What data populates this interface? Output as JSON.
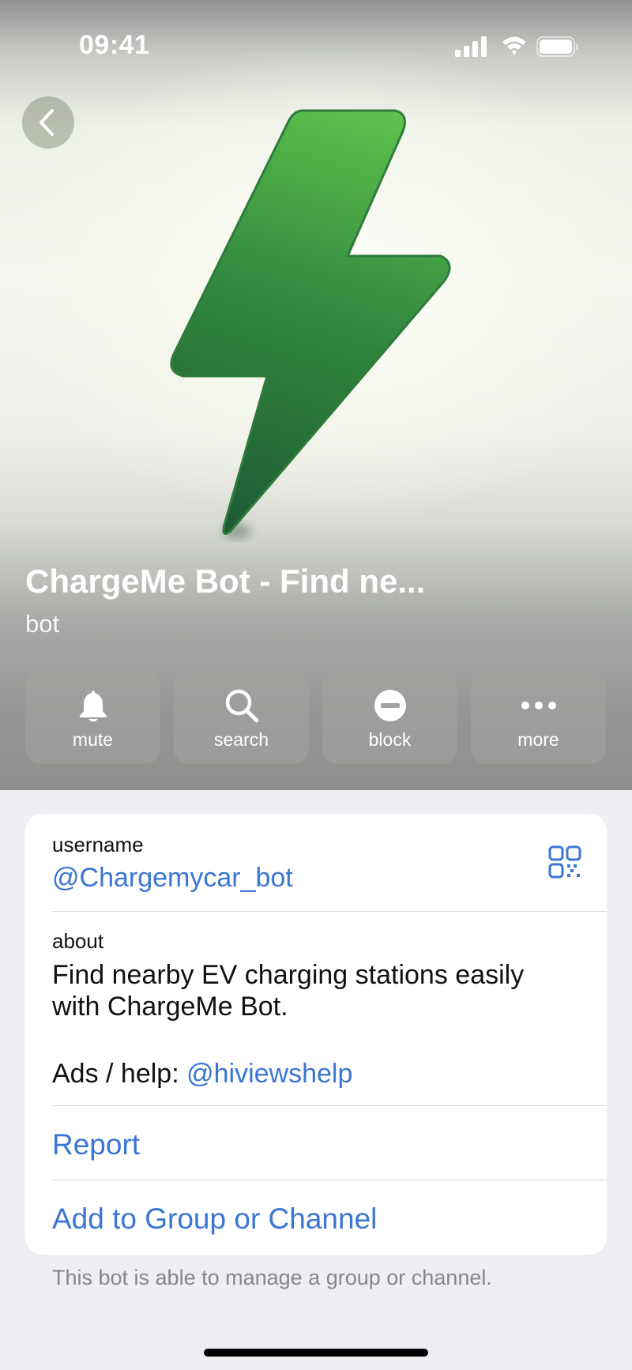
{
  "status_bar": {
    "time": "09:41"
  },
  "profile": {
    "name": "ChargeMe Bot - Find ne...",
    "subtitle": "bot"
  },
  "actions": [
    {
      "label": "mute",
      "icon": "bell-icon"
    },
    {
      "label": "search",
      "icon": "search-icon"
    },
    {
      "label": "block",
      "icon": "block-icon"
    },
    {
      "label": "more",
      "icon": "more-icon"
    }
  ],
  "info": {
    "username_label": "username",
    "username_value": "@Chargemycar_bot",
    "about_label": "about",
    "about_text": "Find nearby EV charging stations easily with ChargeMe Bot.",
    "ads_prefix": "Ads / help: ",
    "ads_link": "@hiviewshelp",
    "report_label": "Report",
    "add_group_label": "Add to Group or Channel"
  },
  "footnote": "This bot is able to manage a group or channel.",
  "colors": {
    "link": "#3a76d3",
    "bolt_light": "#5cc24c",
    "bolt_dark": "#1e5a34",
    "page_bg": "#eeeef3"
  }
}
